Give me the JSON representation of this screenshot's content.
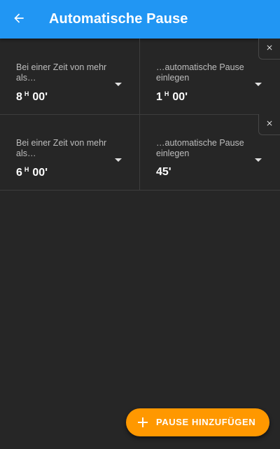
{
  "appbar": {
    "title": "Automatische Pause",
    "back_icon": "arrow-back-icon",
    "color": "#2196F3"
  },
  "rules": [
    {
      "threshold_label": "Bei einer Zeit von mehr als…",
      "threshold_hours": "8",
      "hour_unit": "H",
      "threshold_minutes": "00'",
      "pause_label": "…automatische Pause einlegen",
      "pause_hours": "1",
      "pause_hour_unit": "H",
      "pause_minutes": "00'"
    },
    {
      "threshold_label": "Bei einer Zeit von mehr als…",
      "threshold_hours": "6",
      "hour_unit": "H",
      "threshold_minutes": "00'",
      "pause_label": "…automatische Pause einlegen",
      "pause_value": "45'"
    }
  ],
  "fab": {
    "label": "PAUSE HINZUFÜGEN",
    "icon": "plus-icon",
    "color": "#FF9800"
  },
  "background_color": "#262626"
}
